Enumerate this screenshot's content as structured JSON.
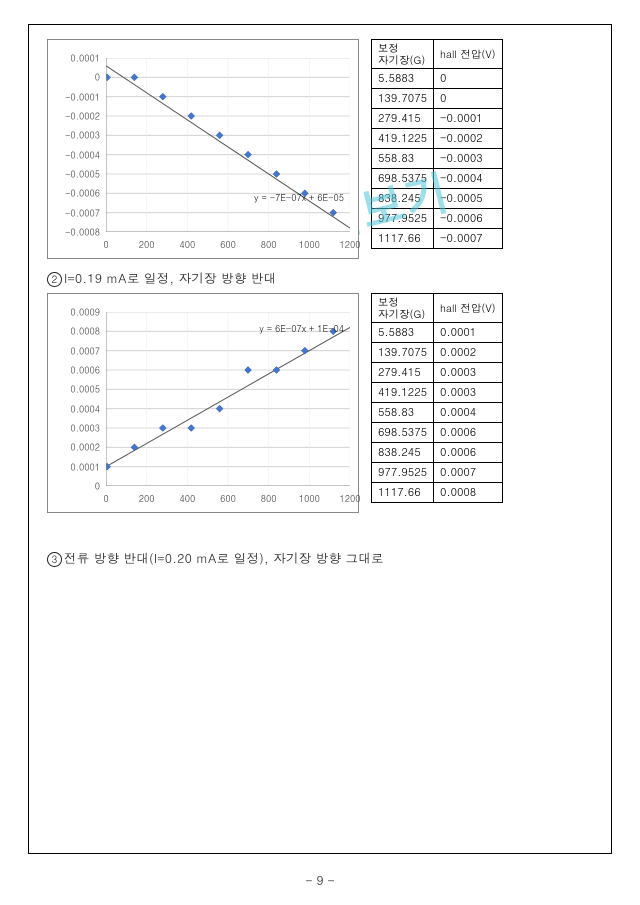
{
  "page_number_text": "- 9 -",
  "watermark_text": "미리보기",
  "section2": {
    "caption_prefix": "②",
    "caption_text": "I=0.19 mA로 일정, 자기장 방향 반대"
  },
  "section3": {
    "caption_prefix": "③",
    "caption_text": "전류 방향 반대(I=0.20 mA로 일정), 자기장 방향 그대로"
  },
  "table_headers": {
    "col1_line1": "보정",
    "col1_line2": "자기장(G)",
    "col2": "hall 전압(V)"
  },
  "table1_rows": [
    {
      "g": "5.5883",
      "v": "0"
    },
    {
      "g": "139.7075",
      "v": "0"
    },
    {
      "g": "279.415",
      "v": "-0.0001"
    },
    {
      "g": "419.1225",
      "v": "-0.0002"
    },
    {
      "g": "558.83",
      "v": "-0.0003"
    },
    {
      "g": "698.5375",
      "v": "-0.0004"
    },
    {
      "g": "838.245",
      "v": "-0.0005"
    },
    {
      "g": "977.9525",
      "v": "-0.0006"
    },
    {
      "g": "1117.66",
      "v": "-0.0007"
    }
  ],
  "table2_rows": [
    {
      "g": "5.5883",
      "v": "0.0001"
    },
    {
      "g": "139.7075",
      "v": "0.0002"
    },
    {
      "g": "279.415",
      "v": "0.0003"
    },
    {
      "g": "419.1225",
      "v": "0.0003"
    },
    {
      "g": "558.83",
      "v": "0.0004"
    },
    {
      "g": "698.5375",
      "v": "0.0006"
    },
    {
      "g": "838.245",
      "v": "0.0006"
    },
    {
      "g": "977.9525",
      "v": "0.0007"
    },
    {
      "g": "1117.66",
      "v": "0.0008"
    }
  ],
  "chart_data": [
    {
      "type": "scatter",
      "equation": "y = -7E-07x + 6E-05",
      "xlabel": "",
      "ylabel": "",
      "xlim": [
        0,
        1200
      ],
      "ylim": [
        -0.0008,
        0.0001
      ],
      "xticks": [
        0,
        200,
        400,
        600,
        800,
        1000,
        1200
      ],
      "yticks": [
        0.0001,
        0,
        -0.0001,
        -0.0002,
        -0.0003,
        -0.0004,
        -0.0005,
        -0.0006,
        -0.0007,
        -0.0008
      ],
      "points": [
        {
          "x": 5.5883,
          "y": 0
        },
        {
          "x": 139.7075,
          "y": 0
        },
        {
          "x": 279.415,
          "y": -0.0001
        },
        {
          "x": 419.1225,
          "y": -0.0002
        },
        {
          "x": 558.83,
          "y": -0.0003
        },
        {
          "x": 698.5375,
          "y": -0.0004
        },
        {
          "x": 838.245,
          "y": -0.0005
        },
        {
          "x": 977.9525,
          "y": -0.0006
        },
        {
          "x": 1117.66,
          "y": -0.0007
        }
      ],
      "trend": {
        "slope": -7e-07,
        "intercept": 6e-05
      }
    },
    {
      "type": "scatter",
      "equation": "y = 6E-07x + 1E-04",
      "xlabel": "",
      "ylabel": "",
      "xlim": [
        0,
        1200
      ],
      "ylim": [
        0,
        0.0009
      ],
      "xticks": [
        0,
        200,
        400,
        600,
        800,
        1000,
        1200
      ],
      "yticks": [
        0.0009,
        0.0008,
        0.0007,
        0.0006,
        0.0005,
        0.0004,
        0.0003,
        0.0002,
        0.0001,
        0
      ],
      "points": [
        {
          "x": 5.5883,
          "y": 0.0001
        },
        {
          "x": 139.7075,
          "y": 0.0002
        },
        {
          "x": 279.415,
          "y": 0.0003
        },
        {
          "x": 419.1225,
          "y": 0.0003
        },
        {
          "x": 558.83,
          "y": 0.0004
        },
        {
          "x": 698.5375,
          "y": 0.0006
        },
        {
          "x": 838.245,
          "y": 0.0006
        },
        {
          "x": 977.9525,
          "y": 0.0007
        },
        {
          "x": 1117.66,
          "y": 0.0008
        }
      ],
      "trend": {
        "slope": 6e-07,
        "intercept": 0.0001
      }
    }
  ]
}
